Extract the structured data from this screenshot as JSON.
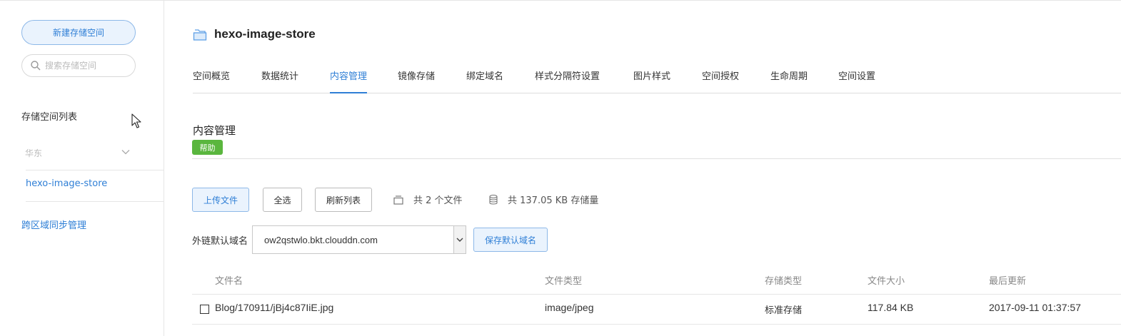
{
  "sidebar": {
    "new_bucket_button": "新建存储空间",
    "search_placeholder": "搜索存储空间",
    "list_title": "存储空间列表",
    "region": "华东",
    "buckets": [
      "hexo-image-store"
    ],
    "cross_region_sync": "跨区域同步管理"
  },
  "header": {
    "bucket_name": "hexo-image-store",
    "tabs": [
      "空间概览",
      "数据统计",
      "内容管理",
      "镜像存储",
      "绑定域名",
      "样式分隔符设置",
      "图片样式",
      "空间授权",
      "生命周期",
      "空间设置"
    ],
    "active_tab": "内容管理"
  },
  "content": {
    "section_title": "内容管理",
    "help_badge": "帮助",
    "toolbar": {
      "upload": "上传文件",
      "select_all": "全选",
      "refresh": "刷新列表",
      "file_count": "共 2 个文件",
      "storage_used": "共 137.05 KB 存储量"
    },
    "domain": {
      "label": "外链默认域名",
      "value": "ow2qstwlo.bkt.clouddn.com",
      "save_button": "保存默认域名"
    },
    "table": {
      "columns": [
        "文件名",
        "文件类型",
        "存储类型",
        "文件大小",
        "最后更新"
      ],
      "rows": [
        {
          "name": "Blog/170911/jBj4c87IiE.jpg",
          "type": "image/jpeg",
          "storage": "标准存储",
          "size": "117.84 KB",
          "updated": "2017-09-11 01:37:57"
        }
      ]
    }
  },
  "colors": {
    "accent": "#2f7fd6",
    "help_green": "#5ab63e"
  }
}
